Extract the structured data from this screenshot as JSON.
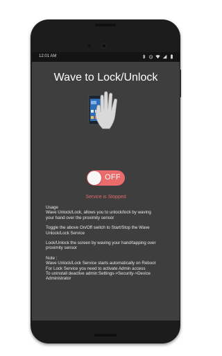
{
  "status_bar": {
    "time": "12:01 AM",
    "icons": [
      "bluetooth-icon",
      "alarm-icon",
      "wifi-icon",
      "signal-icon",
      "battery-icon"
    ]
  },
  "app": {
    "title": "Wave to Lock/Unlock",
    "toggle": {
      "label": "OFF",
      "state": "off",
      "color": "#e96b6b"
    },
    "service_status": "Service is Stopped",
    "service_status_color": "#e26a6a",
    "usage": {
      "heading": "Usage",
      "para1": [
        "Wave Unlock/Lock, allows you to unlock/lock by waving",
        "your hand over the proximity sensor"
      ],
      "para2": [
        "Toggle the above On/Off switch to Start/Stop the Wave",
        "Unlock/Lock Service"
      ],
      "para3": [
        "Lock/Unlock the screen by waving your hand/tapping over",
        "proximity sensor"
      ],
      "note_heading": "Note :",
      "note": [
        "Wave Unlock/Lock Service starts automatically on Reboot",
        "For Lock Service you need to activate Admin access",
        "To uninstall deactive admin:Settings->Security->Device",
        "Administrator"
      ]
    }
  },
  "colors": {
    "background": "#3e3e3e",
    "phone_body": "#1c1c1c",
    "status_bar": "#141414",
    "text": "#e8e8e8"
  }
}
